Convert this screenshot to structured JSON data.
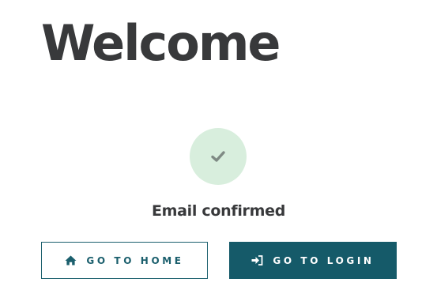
{
  "page": {
    "title": "Welcome"
  },
  "confirmation": {
    "icon": "checkmark-icon",
    "status_text": "Email confirmed"
  },
  "actions": {
    "home_label": "GO TO HOME",
    "home_icon": "home-icon",
    "login_label": "GO TO LOGIN",
    "login_icon": "sign-in-icon"
  },
  "colors": {
    "heading": "#38393b",
    "accent": "#155a69",
    "success_bg": "#d8eedd",
    "check": "#7f8a84"
  }
}
